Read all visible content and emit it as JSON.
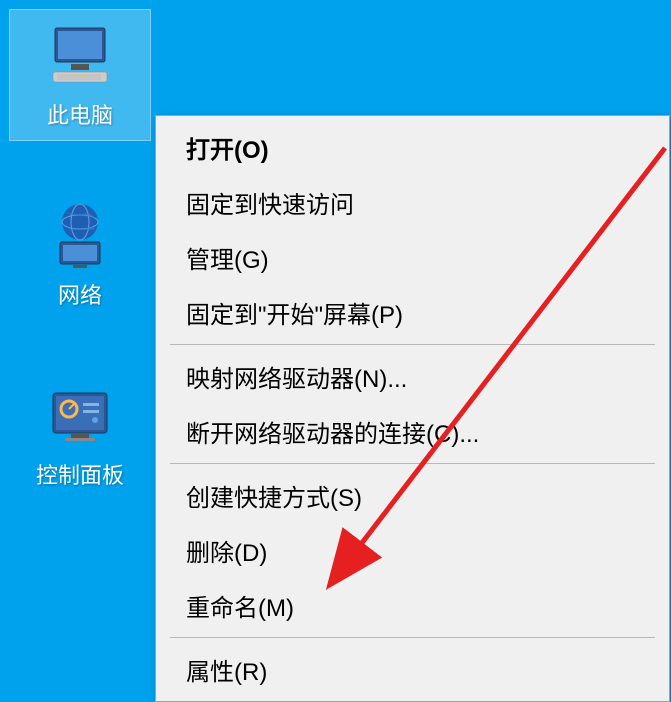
{
  "desktop": {
    "icons": [
      {
        "id": "this-pc",
        "label": "此电脑",
        "selected": true
      },
      {
        "id": "network",
        "label": "网络",
        "selected": false
      },
      {
        "id": "control-panel",
        "label": "控制面板",
        "selected": false
      }
    ]
  },
  "context_menu": {
    "groups": [
      [
        {
          "id": "open",
          "label": "打开(O)",
          "bold": true
        },
        {
          "id": "pin-quick-access",
          "label": "固定到快速访问",
          "bold": false
        },
        {
          "id": "manage",
          "label": "管理(G)",
          "bold": false
        },
        {
          "id": "pin-start",
          "label": "固定到\"开始\"屏幕(P)",
          "bold": false
        }
      ],
      [
        {
          "id": "map-drive",
          "label": "映射网络驱动器(N)...",
          "bold": false
        },
        {
          "id": "disconnect-drive",
          "label": "断开网络驱动器的连接(C)...",
          "bold": false
        }
      ],
      [
        {
          "id": "create-shortcut",
          "label": "创建快捷方式(S)",
          "bold": false
        },
        {
          "id": "delete",
          "label": "删除(D)",
          "bold": false
        },
        {
          "id": "rename",
          "label": "重命名(M)",
          "bold": false
        }
      ],
      [
        {
          "id": "properties",
          "label": "属性(R)",
          "bold": false
        }
      ]
    ]
  }
}
